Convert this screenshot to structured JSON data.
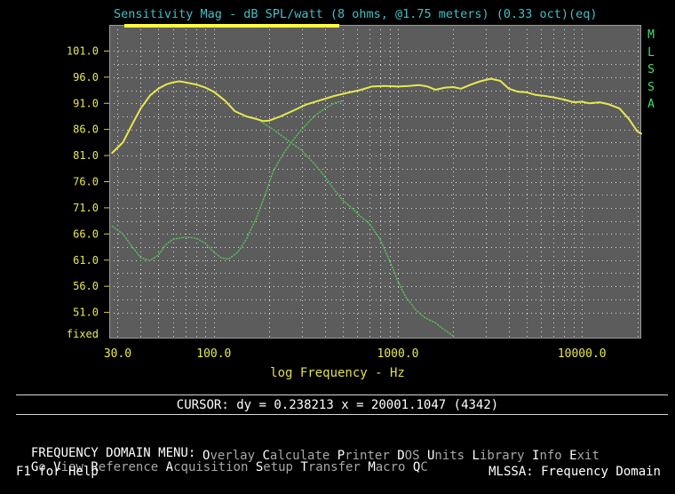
{
  "chart_data": {
    "type": "line",
    "title": "Sensitivity Mag - dB SPL/watt (8 ohms, @1.75 meters) (0.33 oct)(eq)",
    "xlabel": "log Frequency - Hz",
    "ylabel": "",
    "xscale": "log",
    "xlim": [
      27,
      21000
    ],
    "ylim": [
      46,
      106
    ],
    "yticks": [
      {
        "value": 101,
        "label": "101.0"
      },
      {
        "value": 96,
        "label": "96.0"
      },
      {
        "value": 91,
        "label": "91.0"
      },
      {
        "value": 86,
        "label": "86.0"
      },
      {
        "value": 81,
        "label": "81.0"
      },
      {
        "value": 76,
        "label": "76.0"
      },
      {
        "value": 71,
        "label": "71.0"
      },
      {
        "value": 66,
        "label": "66.0"
      },
      {
        "value": 61,
        "label": "61.0"
      },
      {
        "value": 56,
        "label": "56.0"
      },
      {
        "value": 51,
        "label": "51.0"
      }
    ],
    "ybottom_label": "fixed",
    "xticks": [
      {
        "value": 30,
        "label": "30.0"
      },
      {
        "value": 100,
        "label": "100.0"
      },
      {
        "value": 1000,
        "label": "1000.0"
      },
      {
        "value": 10000,
        "label": "10000.0"
      }
    ],
    "grid": true,
    "series": [
      {
        "color": "#e8e850",
        "style": "solid",
        "points": [
          [
            28,
            81.5
          ],
          [
            32,
            83.5
          ],
          [
            36,
            87
          ],
          [
            40,
            90
          ],
          [
            45,
            92.5
          ],
          [
            50,
            93.8
          ],
          [
            55,
            94.6
          ],
          [
            60,
            95
          ],
          [
            65,
            95.2
          ],
          [
            70,
            95
          ],
          [
            80,
            94.6
          ],
          [
            90,
            94
          ],
          [
            100,
            93.2
          ],
          [
            115,
            91.5
          ],
          [
            130,
            89.5
          ],
          [
            150,
            88.5
          ],
          [
            170,
            88
          ],
          [
            185,
            87.6
          ],
          [
            200,
            87.7
          ],
          [
            230,
            88.5
          ],
          [
            270,
            89.6
          ],
          [
            320,
            90.8
          ],
          [
            380,
            91.6
          ],
          [
            450,
            92.4
          ],
          [
            530,
            93
          ],
          [
            620,
            93.5
          ],
          [
            720,
            94.2
          ],
          [
            850,
            94.3
          ],
          [
            1000,
            94.2
          ],
          [
            1150,
            94.3
          ],
          [
            1300,
            94.5
          ],
          [
            1450,
            94.2
          ],
          [
            1600,
            93.6
          ],
          [
            1800,
            94
          ],
          [
            2000,
            94.1
          ],
          [
            2200,
            93.8
          ],
          [
            2500,
            94.6
          ],
          [
            2800,
            95.2
          ],
          [
            3200,
            95.7
          ],
          [
            3600,
            95.3
          ],
          [
            4000,
            93.8
          ],
          [
            4500,
            93.2
          ],
          [
            5000,
            93.1
          ],
          [
            5600,
            92.6
          ],
          [
            6300,
            92.4
          ],
          [
            7100,
            92.1
          ],
          [
            8000,
            91.7
          ],
          [
            9000,
            91.2
          ],
          [
            10000,
            91.3
          ],
          [
            11000,
            91
          ],
          [
            12500,
            91.2
          ],
          [
            14000,
            90.8
          ],
          [
            16000,
            90
          ],
          [
            18000,
            88
          ],
          [
            20000,
            85.6
          ],
          [
            21000,
            85.2
          ]
        ]
      },
      {
        "color": "#58c058",
        "style": "dotted",
        "points": [
          [
            28,
            67.5
          ],
          [
            32,
            66
          ],
          [
            36,
            63.5
          ],
          [
            40,
            61.5
          ],
          [
            45,
            60.9
          ],
          [
            50,
            62
          ],
          [
            55,
            64
          ],
          [
            60,
            65
          ],
          [
            70,
            65.4
          ],
          [
            80,
            65.2
          ],
          [
            90,
            64.2
          ],
          [
            100,
            62.5
          ],
          [
            110,
            61.4
          ],
          [
            120,
            61.2
          ],
          [
            135,
            62.5
          ],
          [
            150,
            65
          ],
          [
            170,
            69
          ],
          [
            190,
            73.5
          ],
          [
            210,
            78
          ],
          [
            240,
            81.5
          ],
          [
            270,
            84
          ],
          [
            300,
            86
          ],
          [
            350,
            88.5
          ],
          [
            400,
            90
          ],
          [
            450,
            91
          ],
          [
            500,
            91.5
          ]
        ]
      },
      {
        "color": "#58c058",
        "style": "dotted",
        "points": [
          [
            180,
            87.5
          ],
          [
            210,
            86
          ],
          [
            250,
            84
          ],
          [
            300,
            82
          ],
          [
            350,
            79.5
          ],
          [
            400,
            77
          ],
          [
            450,
            74.5
          ],
          [
            500,
            72.5
          ],
          [
            560,
            71
          ],
          [
            620,
            69.5
          ],
          [
            700,
            68
          ],
          [
            800,
            65
          ],
          [
            900,
            61
          ],
          [
            1000,
            57
          ],
          [
            1100,
            54
          ],
          [
            1250,
            51.5
          ],
          [
            1400,
            50
          ],
          [
            1600,
            49
          ],
          [
            1800,
            47.6
          ],
          [
            2000,
            46.5
          ]
        ]
      }
    ],
    "overlay_bar_color": "#ffff40"
  },
  "side_label": [
    "M",
    "L",
    "S",
    "S",
    "A"
  ],
  "cursor_readout": "CURSOR: dy = 0.238213 x = 20001.1047 (4342)",
  "menu": {
    "label": "FREQUENCY DOMAIN MENU:",
    "row1": [
      {
        "hot": "G",
        "rest": "o"
      },
      {
        "hot": "V",
        "rest": "iew"
      },
      {
        "hot": "R",
        "rest": "eference"
      },
      {
        "hot": "A",
        "rest": "cquisition"
      },
      {
        "hot": "S",
        "rest": "etup"
      },
      {
        "hot": "T",
        "rest": "ransfer"
      },
      {
        "hot": "M",
        "rest": "acro"
      },
      {
        "hot": "Q",
        "rest": "C"
      }
    ],
    "row2": [
      {
        "hot": "O",
        "rest": "verlay"
      },
      {
        "hot": "C",
        "rest": "alculate"
      },
      {
        "hot": "P",
        "rest": "rinter"
      },
      {
        "hot": "D",
        "rest": "OS"
      },
      {
        "hot": "U",
        "rest": "nits"
      },
      {
        "hot": "L",
        "rest": "ibrary"
      },
      {
        "hot": "I",
        "rest": "nfo"
      },
      {
        "hot": "E",
        "rest": "xit"
      }
    ]
  },
  "help_text": "F1 for Help",
  "mode_text": "MLSSA: Frequency Domain"
}
